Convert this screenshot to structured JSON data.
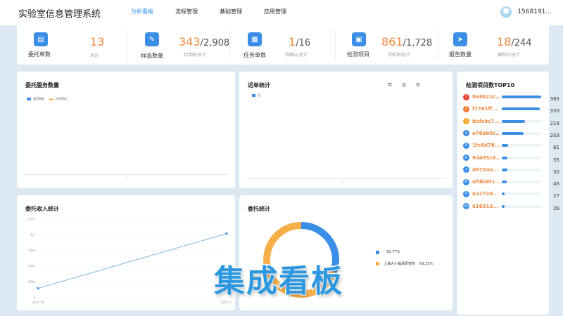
{
  "header": {
    "app_title": "实验室信息管理系统",
    "nav": [
      {
        "label": "分析看板",
        "active": true
      },
      {
        "label": "流程管理",
        "active": false
      },
      {
        "label": "基础管理",
        "active": false
      },
      {
        "label": "应用管理",
        "active": false
      }
    ],
    "user": "1568191..."
  },
  "stats": [
    {
      "label": "委托单数",
      "value": "13",
      "total": "",
      "sub": "总计"
    },
    {
      "label": "样品数量",
      "value": "343",
      "total": "/2,908",
      "sub": "待接收/总计"
    },
    {
      "label": "任务单数",
      "value": "1",
      "total": "/16",
      "sub": "待确认/总计"
    },
    {
      "label": "检测项目",
      "value": "861",
      "total": "/1,728",
      "sub": "待检测/总计"
    },
    {
      "label": "报告数量",
      "value": "18",
      "total": "/244",
      "sub": "编制中/总计"
    }
  ],
  "panels": {
    "service_count": {
      "title": "委托服务数量",
      "legend": [
        "委托数量",
        "检测费用"
      ],
      "x_tick": "0"
    },
    "overdue": {
      "title": "迟单统计",
      "legend": [
        "空"
      ],
      "tabs": [
        "年",
        "月",
        "日"
      ],
      "x_tick": "0"
    },
    "top10": {
      "title": "检测项目数TOP10",
      "items": [
        {
          "rank": "1",
          "name": "8e8621c...",
          "value": 365,
          "color": "#e8402f"
        },
        {
          "rank": "2",
          "name": "f7761ff...",
          "value": 350,
          "color": "#f07a2f"
        },
        {
          "rank": "3",
          "name": "bbfcbc7...",
          "value": 218,
          "color": "#f5a623"
        },
        {
          "rank": "4",
          "name": "e76ab6c...",
          "value": 203,
          "color": "#3a8ee6"
        },
        {
          "rank": "5",
          "name": "1fc6d78...",
          "value": 61,
          "color": "#3a8ee6"
        },
        {
          "rank": "6",
          "name": "9d495c8...",
          "value": 55,
          "color": "#3a8ee6"
        },
        {
          "rank": "7",
          "name": "d9724e...",
          "value": 50,
          "color": "#3a8ee6"
        },
        {
          "rank": "8",
          "name": "afdb601...",
          "value": 45,
          "color": "#3a8ee6"
        },
        {
          "rank": "9",
          "name": "a2272d...",
          "value": 27,
          "color": "#3a8ee6"
        },
        {
          "rank": "10",
          "name": "616013...",
          "value": 26,
          "color": "#3a8ee6"
        }
      ],
      "max": 365
    },
    "income": {
      "title": "委托收入统计",
      "y_ticks": [
        "1.25万",
        "1万",
        "7500",
        "5000",
        "2500",
        "0"
      ],
      "x_ticks": [
        "2022-10",
        "2022-11"
      ]
    },
    "commission": {
      "title": "委托统计",
      "legend": [
        {
          "name": "",
          "pct": "30.77%",
          "color": "#3a8ee6"
        },
        {
          "name": "上海大小输承研究所",
          "pct": "69.23%",
          "color": "#f5b04a"
        }
      ]
    }
  },
  "chart_data": [
    {
      "type": "line",
      "title": "委托收入统计",
      "x": [
        "2022-10",
        "2022-11"
      ],
      "series": [
        {
          "values": [
            1500,
            10200
          ]
        }
      ],
      "ylim": [
        0,
        12500
      ]
    },
    {
      "type": "pie",
      "title": "委托统计",
      "labels": [
        "",
        "上海大小输承研究所"
      ],
      "values": [
        30.77,
        69.23
      ]
    }
  ],
  "overlay": "集成看板"
}
